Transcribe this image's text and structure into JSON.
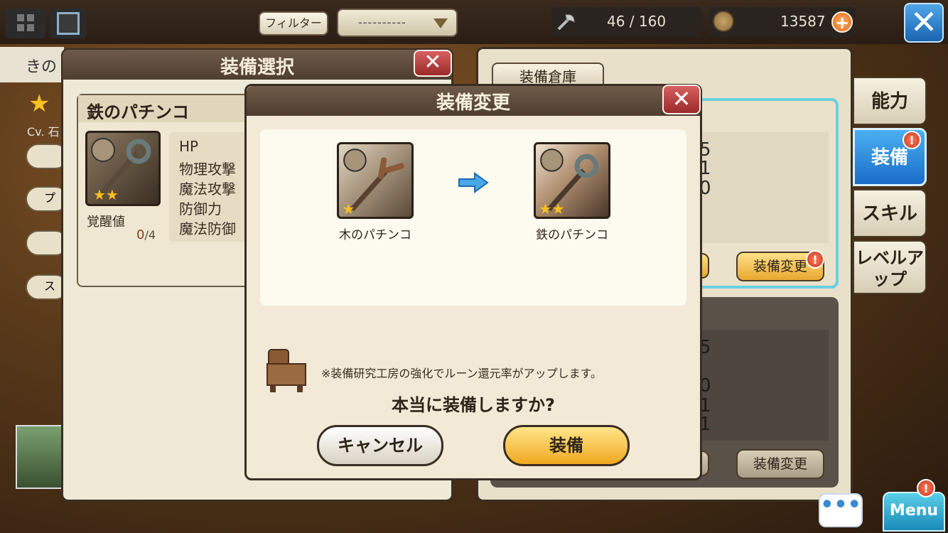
{
  "topbar": {
    "filter_label": "フィルター",
    "filter_value": "----------",
    "capacity": "46 / 160",
    "currency": "13587",
    "plus": "+",
    "close": "✕"
  },
  "left": {
    "partial_label": "きの",
    "cv_text": "Cv. 石",
    "pill_labels": [
      "",
      "プ",
      "",
      "ス"
    ]
  },
  "selection_panel": {
    "title": "装備選択",
    "close": "✕",
    "item_name": "鉄のパチンコ",
    "stats": [
      "HP",
      "物理攻撃",
      "魔法攻撃",
      "防御力",
      "魔法防御"
    ],
    "awaken_label": "覚醒値",
    "awaken_current": "0",
    "awaken_max": "/4"
  },
  "right_panel": {
    "warehouse_tab": "装備倉庫",
    "card1_values": [
      "5",
      "1",
      "0"
    ],
    "card2_values": [
      "5",
      "0",
      "1",
      "1"
    ],
    "equip_change": "装備変更",
    "warn": "!"
  },
  "side_tabs": [
    {
      "label": "能力",
      "active": false
    },
    {
      "label": "装備",
      "active": true
    },
    {
      "label": "スキル",
      "active": false
    },
    {
      "label": "レベルアップ",
      "active": false
    }
  ],
  "modal": {
    "title": "装備変更",
    "close": "✕",
    "from_item": {
      "name": "木のパチンコ",
      "stars": 1
    },
    "to_item": {
      "name": "鉄のパチンコ",
      "stars": 2
    },
    "note": "※装備研究工房の強化でルーン還元率がアップします。",
    "confirm": "本当に装備しますか?",
    "cancel": "キャンセル",
    "equip": "装備"
  },
  "bottom": {
    "chat": "•••",
    "menu": "Menu",
    "warn": "!"
  },
  "colors": {
    "accent_blue": "#1a6cc8",
    "gold_button": "#f0a820",
    "close_red": "#9a2a2a",
    "highlight_cyan": "#6ad0e0"
  }
}
